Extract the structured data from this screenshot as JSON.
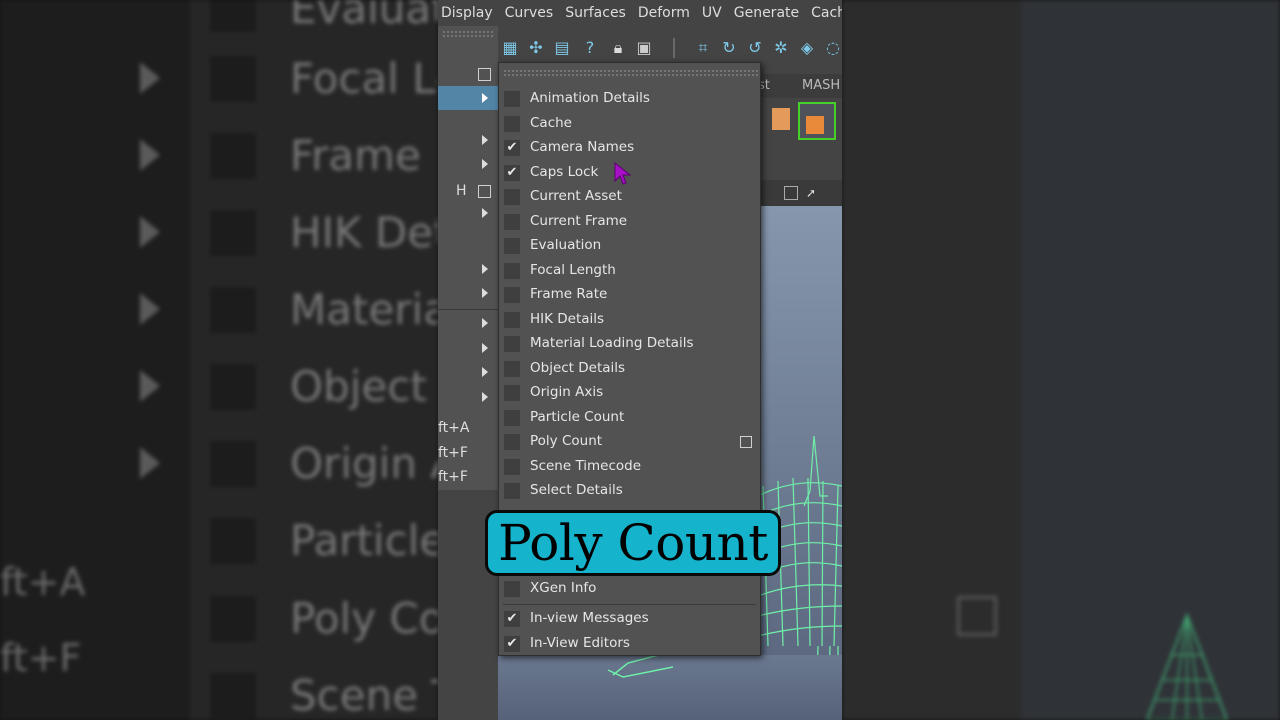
{
  "menubar": [
    "Display",
    "Curves",
    "Surfaces",
    "Deform",
    "UV",
    "Generate",
    "Cach"
  ],
  "shelf_tabs": [
    "st",
    "MASH"
  ],
  "parent_menu": {
    "hotkey_letter": "H",
    "shortcuts": [
      "ft+A",
      "ft+F",
      "ft+F"
    ]
  },
  "submenu": {
    "items": [
      {
        "label": "Animation Details",
        "checked": false
      },
      {
        "label": "Cache",
        "checked": false
      },
      {
        "label": "Camera Names",
        "checked": true
      },
      {
        "label": "Caps Lock",
        "checked": true
      },
      {
        "label": "Current Asset",
        "checked": false
      },
      {
        "label": "Current Frame",
        "checked": false
      },
      {
        "label": "Evaluation",
        "checked": false
      },
      {
        "label": "Focal Length",
        "checked": false
      },
      {
        "label": "Frame Rate",
        "checked": false
      },
      {
        "label": "HIK Details",
        "checked": false
      },
      {
        "label": "Material Loading Details",
        "checked": false
      },
      {
        "label": "Object Details",
        "checked": false
      },
      {
        "label": "Origin Axis",
        "checked": false
      },
      {
        "label": "Particle Count",
        "checked": false
      },
      {
        "label": "Poly Count",
        "checked": false
      },
      {
        "label": "Scene Timecode",
        "checked": false
      },
      {
        "label": "Select Details",
        "checked": false
      }
    ],
    "bottom_items": [
      {
        "label": "XGen Info",
        "checked": false
      },
      {
        "label": "In-view Messages",
        "checked": true
      },
      {
        "label": "In-View Editors",
        "checked": true
      }
    ],
    "check_glyph": "✔"
  },
  "caption": {
    "text": "Poly Count",
    "color": "#15b3cc"
  },
  "background_left": {
    "labels": [
      "Evaluat",
      "Focal Le",
      "Frame R",
      "HIK Det",
      "Materia",
      "Object I",
      "Origin A",
      "Particle",
      "Poly Co",
      "Scene T"
    ],
    "shortcuts": [
      "ft+A",
      "ft+F"
    ]
  },
  "accent": {
    "highlight": "#5285a6",
    "wireframe": "#6ff0a8"
  }
}
